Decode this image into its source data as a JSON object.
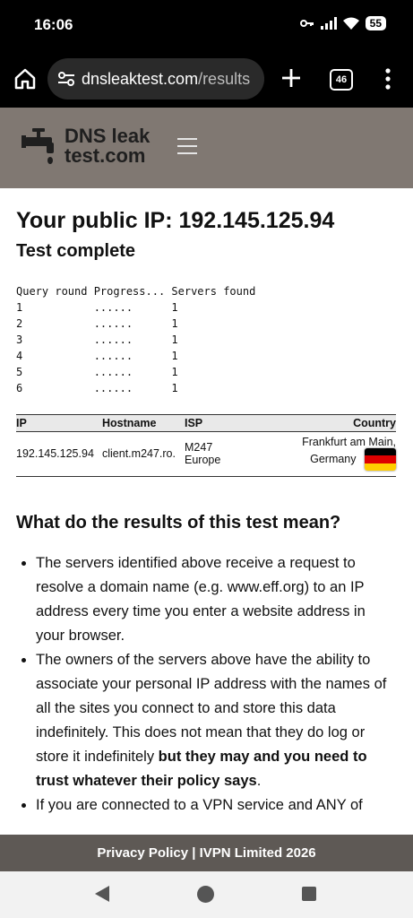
{
  "status": {
    "time": "16:06",
    "battery": "55"
  },
  "browser": {
    "url_host": "dnsleaktest.com",
    "url_path": "/results",
    "tab_count": "46"
  },
  "site": {
    "logo_line1": "DNS leak",
    "logo_line2": "test.com"
  },
  "main": {
    "ip_heading": "Your public IP: 192.145.125.94",
    "status": "Test complete",
    "rounds_text": "Query round Progress... Servers found\n1           ......      1\n2           ......      1\n3           ......      1\n4           ......      1\n5           ......      1\n6           ......      1",
    "table": {
      "headers": {
        "ip": "IP",
        "hostname": "Hostname",
        "isp": "ISP",
        "country": "Country"
      },
      "row": {
        "ip": "192.145.125.94",
        "hostname": "client.m247.ro.",
        "isp_line1": "M247",
        "isp_line2": "Europe",
        "country_line1": "Frankfurt am Main,",
        "country_line2": "Germany"
      }
    },
    "meaning_heading": "What do the results of this test mean?",
    "bullets": {
      "b1": "The servers identified above receive a request to resolve a domain name (e.g. www.eff.org) to an IP address every time you enter a website address in your browser.",
      "b2_plain": "The owners of the servers above have the ability to associate your personal IP address with the names of all the sites you connect to and store this data indefinitely. This does not mean that they do log or store it indefinitely ",
      "b2_bold": "but they may and you need to trust whatever their policy says",
      "b2_end": ".",
      "b3": "If you are connected to a VPN service and ANY of"
    }
  },
  "footer": {
    "text": "Privacy Policy | IVPN Limited 2026"
  },
  "colors": {
    "header_bg": "#807872",
    "footer_bg": "#5e5955",
    "flag_black": "#000000",
    "flag_red": "#dd0000",
    "flag_gold": "#ffce00"
  }
}
